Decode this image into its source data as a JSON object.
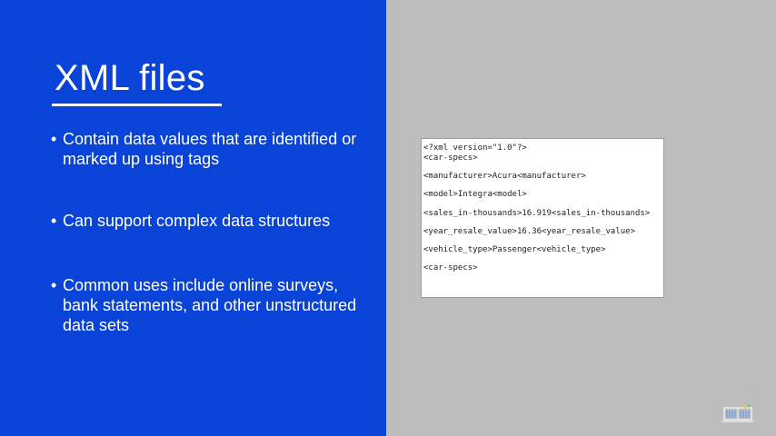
{
  "slide": {
    "title": "XML files",
    "bullets": [
      {
        "marker": "•",
        "text": "Contain data values that are identified or marked up using tags"
      },
      {
        "marker": "•",
        "text": "Can support complex data structures"
      },
      {
        "marker": "•",
        "text": "Common uses include online surveys, bank statements, and other unstructured data sets"
      }
    ]
  },
  "code_sample": {
    "lines": [
      "<?xml version=\"1.0\"?>",
      "<car-specs>",
      "<manufacturer>Acura<manufacturer>",
      "<model>Integra<model>",
      "<sales_in-thousands>16.919<sales_in-thousands>",
      "<year_resale_value>16.36<year_resale_value>",
      "<vehicle_type>Passenger<vehicle_type>",
      "<car-specs>"
    ]
  },
  "colors": {
    "left_panel": "#0a43d8",
    "right_panel": "#bdbdbd",
    "text": "#ffffff"
  },
  "icons": {
    "corner_logo": "book-logo-icon"
  }
}
